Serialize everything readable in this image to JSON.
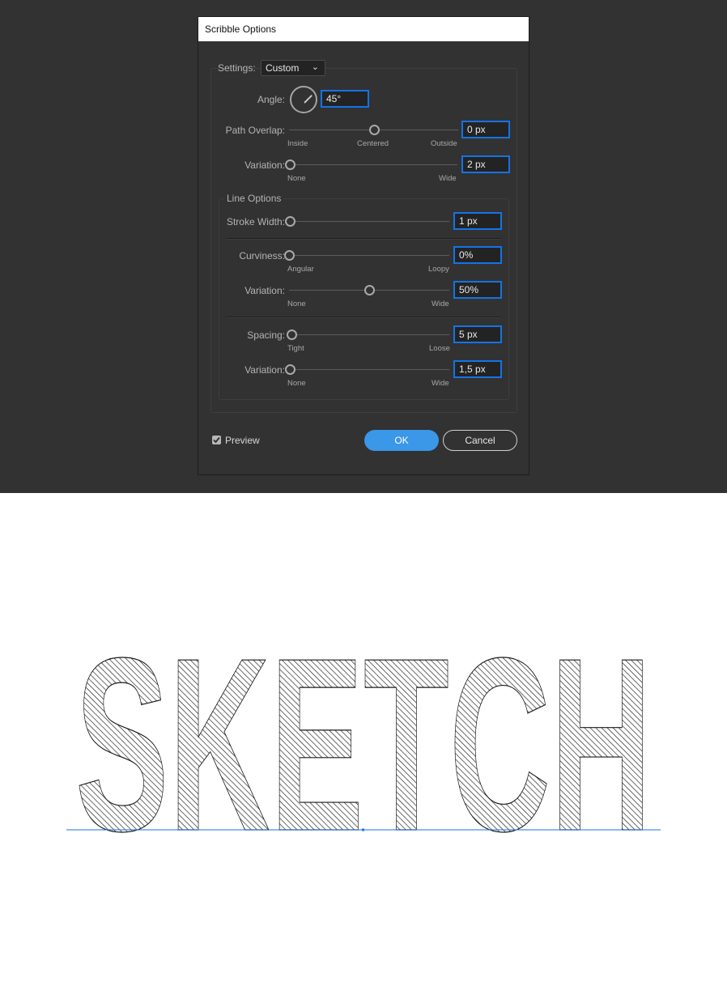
{
  "dialog": {
    "title": "Scribble Options",
    "settings_label": "Settings:",
    "settings_value": "Custom",
    "angle_label": "Angle:",
    "angle_value": "45°",
    "path_overlap": {
      "label": "Path Overlap:",
      "value": "0 px",
      "ticks": [
        "Inside",
        "Centered",
        "Outside"
      ],
      "level": 0.5
    },
    "overlap_variation": {
      "label": "Variation:",
      "value": "2 px",
      "ticks": [
        "None",
        "Wide"
      ],
      "level": 0.0
    },
    "line_options": {
      "legend": "Line Options",
      "stroke_width": {
        "label": "Stroke Width:",
        "value": "1 px",
        "level": 0.0
      },
      "curviness": {
        "label": "Curviness:",
        "value": "0%",
        "ticks": [
          "Angular",
          "Loopy"
        ],
        "level": 0.0
      },
      "curviness_variation": {
        "label": "Variation:",
        "value": "50%",
        "ticks": [
          "None",
          "Wide"
        ],
        "level": 0.5
      },
      "spacing": {
        "label": "Spacing:",
        "value": "5 px",
        "ticks": [
          "Tight",
          "Loose"
        ],
        "level": 0.01
      },
      "spacing_variation": {
        "label": "Variation:",
        "value": "1,5 px",
        "ticks": [
          "None",
          "Wide"
        ],
        "level": 0.0
      }
    },
    "preview_label": "Preview",
    "preview_checked": true,
    "ok_label": "OK",
    "cancel_label": "Cancel"
  },
  "artwork": {
    "text": "SKETCH",
    "stroke_color": "#1a1a1a",
    "baseline_color": "#1473e6"
  },
  "colors": {
    "workspace": "#323232",
    "accent": "#1473e6",
    "ok_button": "#3b97e8"
  }
}
